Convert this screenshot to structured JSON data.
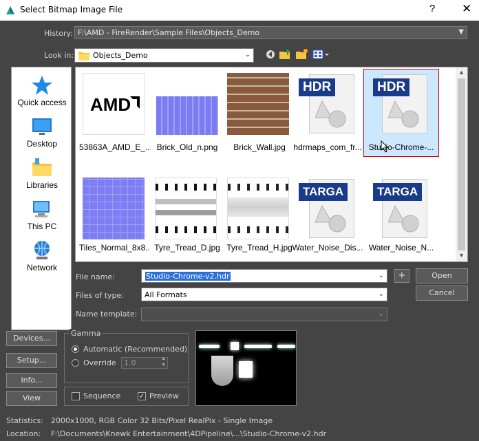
{
  "window": {
    "title": "Select Bitmap Image File",
    "help_glyph": "?",
    "close_glyph": "✕"
  },
  "history": {
    "label": "History:",
    "value": "F:\\AMD - FireRender\\Sample Files\\Objects_Demo"
  },
  "look_in": {
    "label": "Look in:",
    "value": "Objects_Demo"
  },
  "places": [
    {
      "label": "Quick access",
      "icon": "star-icon"
    },
    {
      "label": "Desktop",
      "icon": "desktop-icon"
    },
    {
      "label": "Libraries",
      "icon": "libraries-icon"
    },
    {
      "label": "This PC",
      "icon": "computer-icon"
    },
    {
      "label": "Network",
      "icon": "network-icon"
    }
  ],
  "files": [
    {
      "name": "53863A_AMD_E_...",
      "kind": "amd-logo"
    },
    {
      "name": "Brick_Old_n.png",
      "kind": "brick-normal"
    },
    {
      "name": "Brick_Wall.jpg",
      "kind": "brick-wall"
    },
    {
      "name": "hdrmaps_com_fr...",
      "kind": "hdr",
      "badge": "HDR"
    },
    {
      "name": "Studio-Chrome-...",
      "kind": "hdr",
      "badge": "HDR",
      "selected": true
    },
    {
      "name": "Tiles_Normal_8x8...",
      "kind": "tiles-normal"
    },
    {
      "name": "Tyre_Tread_D.jpg",
      "kind": "tyre"
    },
    {
      "name": "Tyre_Tread_H.jpg",
      "kind": "tyre-h"
    },
    {
      "name": "Water_Noise_Dis...",
      "kind": "targa",
      "badge": "TARGA"
    },
    {
      "name": "Water_Noise_N...",
      "kind": "targa",
      "badge": "TARGA"
    }
  ],
  "amd_logo_text": "AMD",
  "file_name": {
    "label": "File name:",
    "value": "Studio-Chrome-v2.hdr"
  },
  "files_of_type": {
    "label": "Files of type:",
    "value": "All Formats"
  },
  "name_template": {
    "label": "Name template:",
    "value": ""
  },
  "buttons": {
    "plus": "+",
    "open": "Open",
    "cancel": "Cancel",
    "devices": "Devices...",
    "setup": "Setup...",
    "info": "Info...",
    "view": "View"
  },
  "gamma": {
    "title": "Gamma",
    "automatic": "Automatic (Recommended)",
    "override": "Override",
    "override_value": "1.0",
    "selected": "automatic"
  },
  "sequence": {
    "label": "Sequence",
    "checked": false
  },
  "preview": {
    "label": "Preview",
    "checked": true
  },
  "statistics": {
    "label": "Statistics:",
    "value": "2000x1000, RGB Color 32 Bits/Pixel RealPix - Single Image"
  },
  "location": {
    "label": "Location:",
    "value": "F:\\Documents\\Knewk Entertainment\\4DPipeline\\...\\Studio-Chrome-v2.hdr"
  },
  "colors": {
    "selection_fill": "#cce8ff",
    "selection_border": "#e00000",
    "hdr_band": "#1a3a8a"
  }
}
